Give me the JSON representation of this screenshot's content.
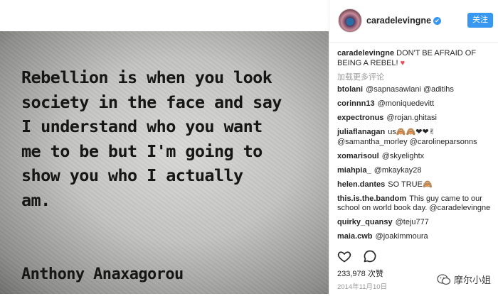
{
  "post_image": {
    "quote_lines": "Rebellion is when you look\nsociety in the face and say\nI understand who you want\nme to be but I'm going to\nshow you who I actually\nam.",
    "author": "Anthony Anaxagorou"
  },
  "header": {
    "username": "caradelevingne",
    "verified": "✔",
    "follow_label": "关注"
  },
  "caption": {
    "username": "caradelevingne",
    "text": "DON'T BE AFRAID OF BEING A REBEL!",
    "emoji": "♥"
  },
  "more_comments": "加载更多评论",
  "comments": [
    {
      "user": "btolani",
      "text": "@sapnasawlani @aditihs"
    },
    {
      "user": "corinnn13",
      "text": "@moniquedevitt"
    },
    {
      "user": "expectronus",
      "text": "@rojan.ghitasi"
    },
    {
      "user": "juliaflanagan",
      "text": "us🙈🙈❤❤✌ @samantha_morley @carolineparsonns"
    },
    {
      "user": "xomarisoul",
      "text": "@skyelightx"
    },
    {
      "user": "miahpia_",
      "text": "@mkaykay28"
    },
    {
      "user": "helen.dantes",
      "text": "SO TRUE🙈"
    },
    {
      "user": "this.is.the.bandom",
      "text": "This guy came to our school on world book day. @caradelevingne"
    },
    {
      "user": "quirky_quansy",
      "text": "@teju777"
    },
    {
      "user": "maia.cwb",
      "text": "@joakimmoura"
    }
  ],
  "actions": {
    "like_icon": "heart-outline-icon",
    "comment_icon": "comment-bubble-icon"
  },
  "likes": "233,978 次赞",
  "date": "2014年11月10日",
  "watermark": "摩尔小姐",
  "colors": {
    "accent": "#3897f0",
    "heart": "#ed4956"
  }
}
